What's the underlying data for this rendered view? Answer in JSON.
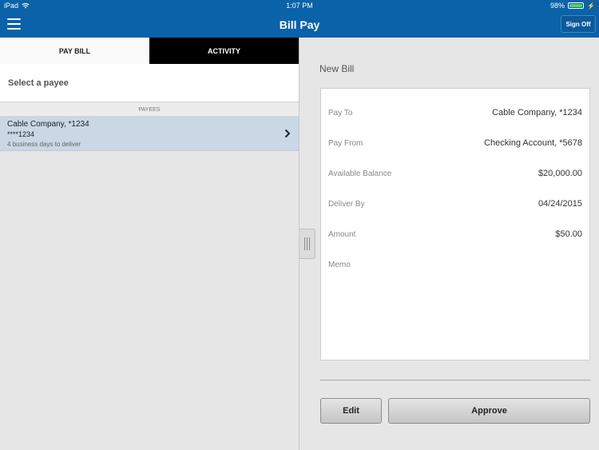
{
  "status_bar": {
    "device": "iPad",
    "time": "1:07 PM",
    "battery_percent": "98%",
    "battery_level": 0.98
  },
  "nav": {
    "title": "Bill Pay",
    "sign_off_label": "Sign Off"
  },
  "tabs": [
    {
      "label": "PAY BILL",
      "active": true
    },
    {
      "label": "ACTIVITY",
      "active": false
    }
  ],
  "left": {
    "select_payee_label": "Select a payee",
    "section_header": "PAYEES",
    "payees": [
      {
        "name": "Cable Company, *1234",
        "account": "****1234",
        "delivery": "4 business days to deliver"
      }
    ]
  },
  "bill": {
    "title": "New Bill",
    "rows": [
      {
        "label": "Pay To",
        "value": "Cable Company, *1234"
      },
      {
        "label": "Pay From",
        "value": "Checking Account, *5678"
      },
      {
        "label": "Available Balance",
        "value": "$20,000.00"
      },
      {
        "label": "Deliver By",
        "value": "04/24/2015"
      },
      {
        "label": "Amount",
        "value": "$50.00"
      },
      {
        "label": "Memo",
        "value": ""
      }
    ],
    "edit_label": "Edit",
    "approve_label": "Approve"
  },
  "colors": {
    "brand": "#0a62a8",
    "selected_row": "#cad7e5",
    "battery": "#5ad35a"
  },
  "icons": [
    "hamburger-icon",
    "wifi-icon",
    "battery-icon",
    "chevron-right-icon",
    "drag-handle-icon"
  ]
}
